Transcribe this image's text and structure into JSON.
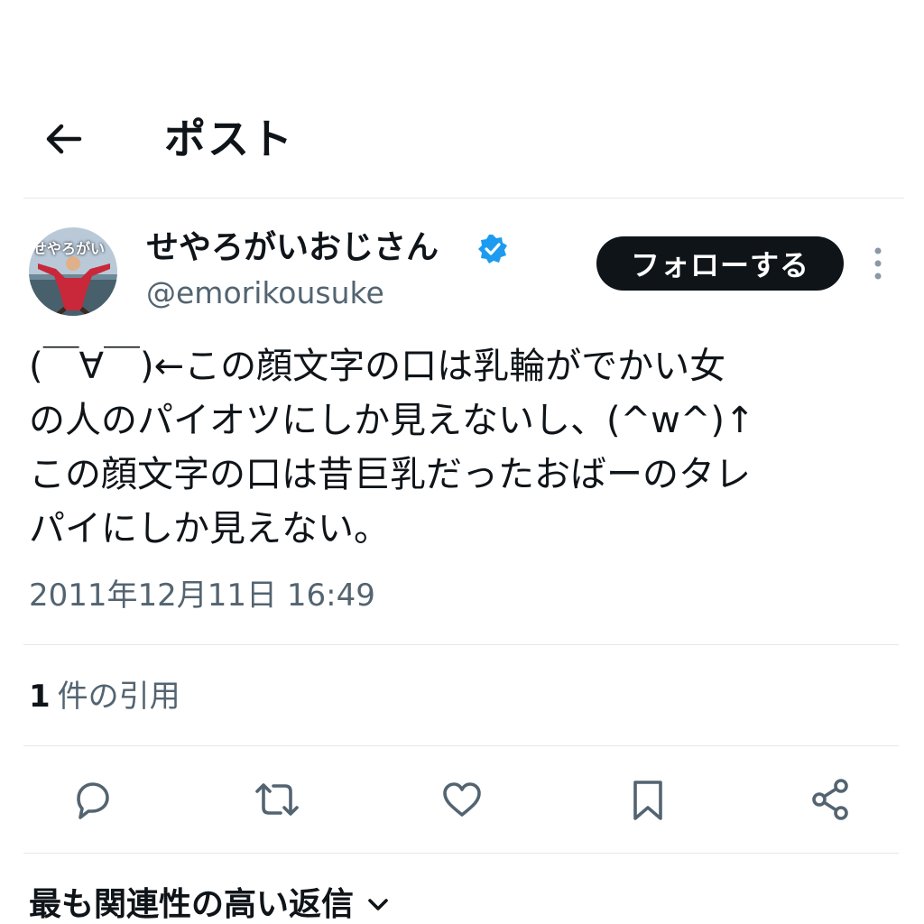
{
  "header": {
    "title": "ポスト",
    "back_icon": "arrow-left-icon"
  },
  "author": {
    "display_name": "せやろがいおじさん",
    "handle": "@emorikousuke",
    "verified": true,
    "avatar_text": "せやろがい",
    "follow_label": "フォローする"
  },
  "tweet": {
    "text": "(￣∀￣)←この顔文字の口は乳輪がでかい女\nの人のパイオツにしか見えないし、(^w^)↑\nこの顔文字の口は昔巨乳だったおばーのタレ\nパイにしか見えない。",
    "timestamp": "2011年12月11日 16:49"
  },
  "engagement": {
    "quote_count": "1",
    "quote_label": "件の引用"
  },
  "actions": [
    "reply-icon",
    "retweet-icon",
    "like-icon",
    "bookmark-icon",
    "share-icon"
  ],
  "replies_sort": {
    "label": "最も関連性の高い返信"
  },
  "colors": {
    "text": "#0f1419",
    "secondary": "#536471",
    "verified_blue": "#1d9bf0",
    "divider": "#e4e7ea"
  }
}
